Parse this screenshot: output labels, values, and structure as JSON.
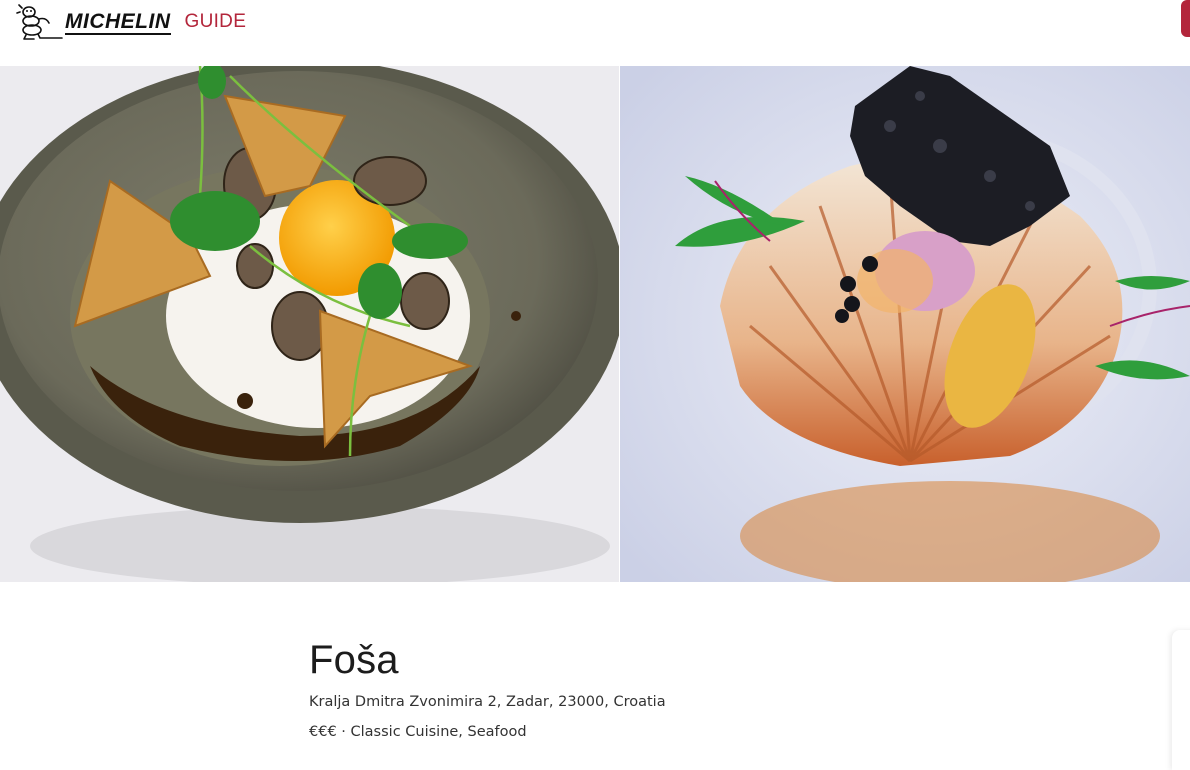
{
  "header": {
    "logo_text": "MICHELIN",
    "guide_text": "GUIDE",
    "brand_color": "#b3263b"
  },
  "gallery": {
    "images": [
      {
        "icon": "food-photo-icon",
        "subject": "dumplings with egg yolk and truffle"
      },
      {
        "icon": "food-photo-icon",
        "subject": "scallop shell dish with squid ink crisp"
      }
    ]
  },
  "restaurant": {
    "name": "Foša",
    "address": "Kralja Dmitra Zvonimira 2, Zadar, 23000, Croatia",
    "price": "€€€",
    "separator": "·",
    "cuisine": "Classic Cuisine, Seafood"
  }
}
